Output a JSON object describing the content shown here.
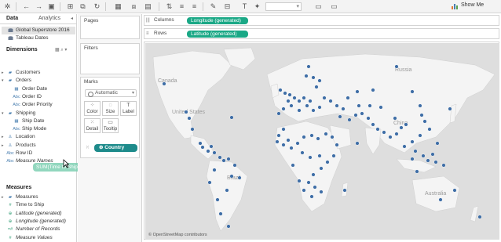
{
  "toolbar": {
    "show_me_label": "Show Me"
  },
  "datapane": {
    "tabs": [
      "Data",
      "Analytics"
    ],
    "datasources": [
      {
        "label": "Global Superstore 2016",
        "selected": true
      },
      {
        "label": "Tableau Dates",
        "selected": false
      }
    ],
    "dimensions_title": "Dimensions",
    "dimensions": [
      {
        "label": "Customers",
        "icon": "folder",
        "expand": "▸"
      },
      {
        "label": "Orders",
        "icon": "folder",
        "expand": "▾"
      },
      {
        "label": "Order Date",
        "icon": "calendar"
      },
      {
        "label": "Order ID",
        "icon": "Abc"
      },
      {
        "label": "Order Priority",
        "icon": "Abc"
      },
      {
        "label": "Shipping",
        "icon": "folder",
        "expand": "▾"
      },
      {
        "label": "Ship Date",
        "icon": "calendar"
      },
      {
        "label": "Ship Mode",
        "icon": "Abc"
      },
      {
        "label": "Location",
        "icon": "hierarchy",
        "expand": "▸"
      },
      {
        "label": "Products",
        "icon": "hierarchy",
        "expand": "▸"
      },
      {
        "label": "Row ID",
        "icon": "Abc"
      },
      {
        "label": "Measure Names",
        "icon": "Abc",
        "italic": true
      }
    ],
    "measures_title": "Measures",
    "measures": [
      {
        "label": "Measures",
        "icon": "folder",
        "expand": "▸"
      },
      {
        "label": "Time to Ship",
        "icon": "#"
      },
      {
        "label": "Latitude (generated)",
        "icon": "globe",
        "italic": true
      },
      {
        "label": "Longitude (generated)",
        "icon": "globe",
        "italic": true
      },
      {
        "label": "Number of Records",
        "icon": "=#",
        "italic": true
      },
      {
        "label": "Measure Values",
        "icon": "#",
        "italic": true
      }
    ],
    "drag_pill": "SUM(Time to Ship)"
  },
  "cards": {
    "pages_title": "Pages",
    "filters_title": "Filters",
    "marks_title": "Marks",
    "mark_type": "Automatic",
    "mark_buttons": [
      "Color",
      "Size",
      "Label",
      "Detail",
      "Tooltip"
    ],
    "detail_pill": "Country"
  },
  "shelves": {
    "columns_label": "Columns",
    "columns_pill": "Longitude (generated)",
    "rows_label": "Rows",
    "rows_pill": "Latitude (generated)"
  },
  "map": {
    "labels": [
      "Canada",
      "United States",
      "Brazil",
      "Russia",
      "China",
      "Australia"
    ],
    "attribution": "© OpenStreetMap contributors",
    "point_color": "#3f6ea6",
    "land_color": "#f4f4f4",
    "water_color": "#dedede"
  }
}
